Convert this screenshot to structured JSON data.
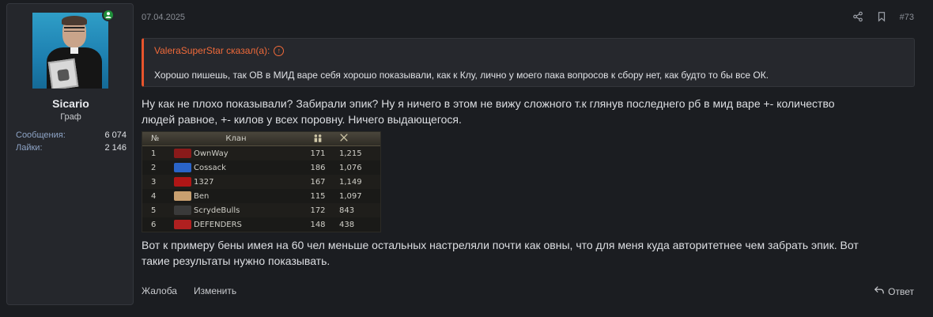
{
  "user": {
    "name": "Sicario",
    "title": "Граф",
    "stats": [
      {
        "label": "Сообщения:",
        "value": "6 074"
      },
      {
        "label": "Лайки:",
        "value": "2 146"
      }
    ]
  },
  "post": {
    "date": "07.04.2025",
    "number": "#73",
    "quote": {
      "author": "ValeraSuperStar сказал(а):",
      "text": "Хорошо пишешь, так ОВ в МИД варе себя хорошо показывали, как к Клу, лично у моего пака вопросов к сбору нет, как будто то бы все ОК."
    },
    "paragraph1_line1": "Ну как не плохо показывали? Забирали эпик? Ну я ничего в этом не вижу сложного т.к глянув последнего рб в мид варе +- количество",
    "paragraph1_line2": "людей равное, +- килов у всех поровну. Ничего выдающегося.",
    "paragraph2_line1": "Вот к примеру бены имея на 60 чел меньше остальных настреляли почти как овны, что для меня куда авторитетнее чем забрать эпик. Вот",
    "paragraph2_line2": "такие результаты нужно показывать."
  },
  "clan_table": {
    "headers": {
      "num": "№",
      "name": "Клан"
    },
    "rows": [
      {
        "num": "1",
        "name": "OwnWay",
        "members": "171",
        "kills": "1,215",
        "icon_color": "#8a1a1a"
      },
      {
        "num": "2",
        "name": "Cossack",
        "members": "186",
        "kills": "1,076",
        "icon_color": "#2a64c8"
      },
      {
        "num": "3",
        "name": "1327",
        "members": "167",
        "kills": "1,149",
        "icon_color": "#b01616"
      },
      {
        "num": "4",
        "name": "Ben",
        "members": "115",
        "kills": "1,097",
        "icon_color": "#c9a070"
      },
      {
        "num": "5",
        "name": "ScrydeBulls",
        "members": "172",
        "kills": "843",
        "icon_color": "#3a3a3a"
      },
      {
        "num": "6",
        "name": "DEFENDERS",
        "members": "148",
        "kills": "438",
        "icon_color": "#b02020"
      }
    ]
  },
  "actions": {
    "report": "Жалоба",
    "edit": "Изменить",
    "reply": "Ответ"
  },
  "colors": {
    "accent": "#f06a3a",
    "online": "#1f8f3a"
  }
}
